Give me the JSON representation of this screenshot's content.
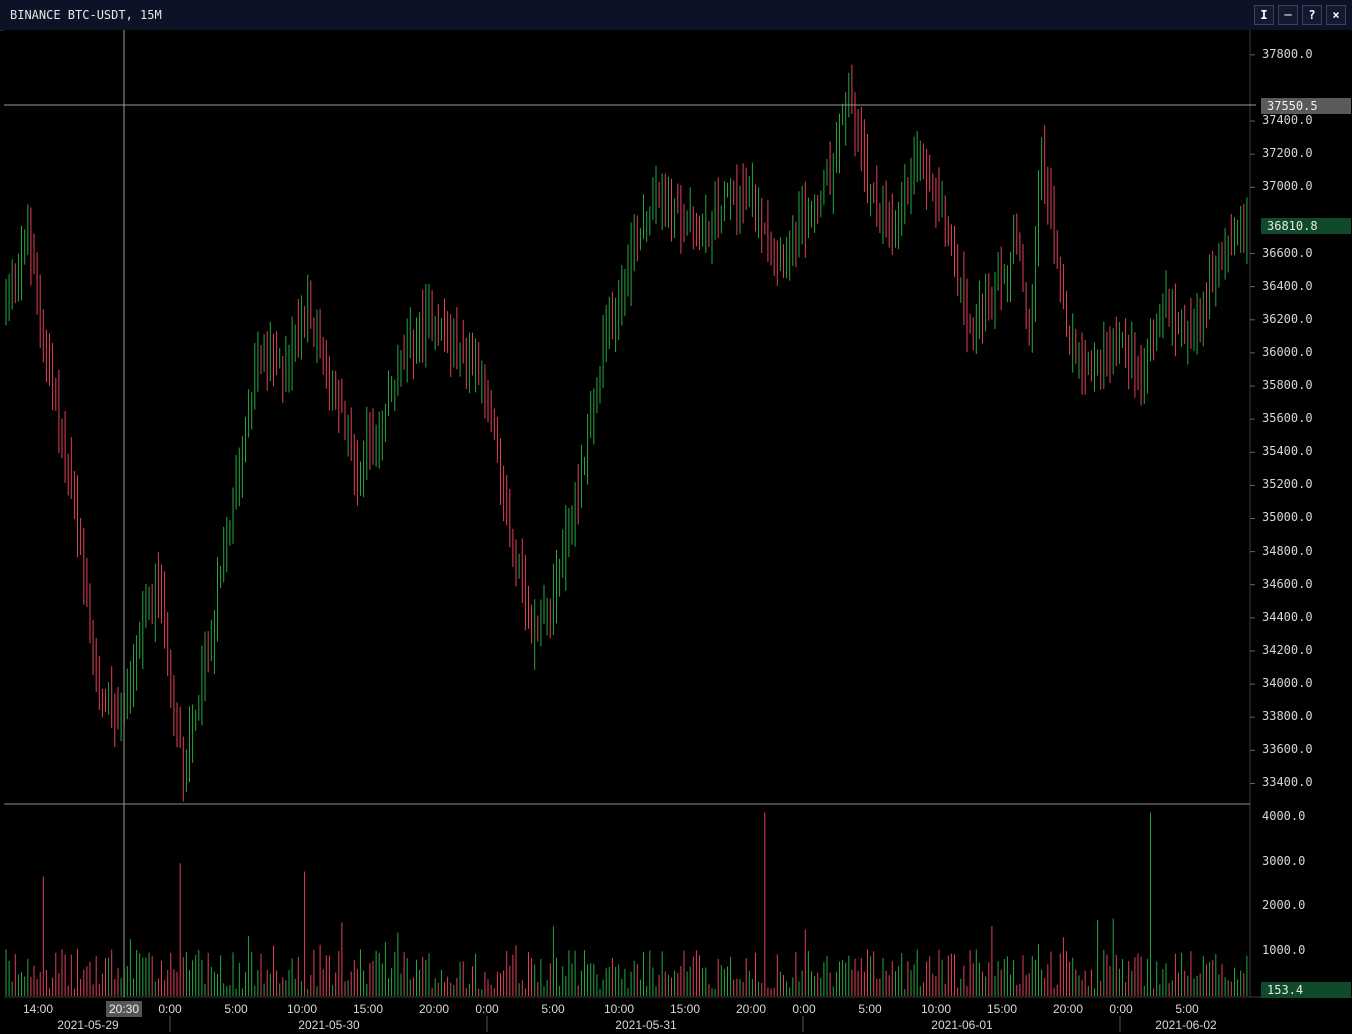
{
  "window": {
    "title": "BINANCE BTC-USDT, 15M",
    "buttons": [
      "I",
      "─",
      "?",
      "×"
    ]
  },
  "chart_data": {
    "type": "bar",
    "subtype": "ohlc",
    "title": "BINANCE BTC-USDT, 15M",
    "price_axis_labels": [
      "37800.0",
      "37400.0",
      "37200.0",
      "37000.0",
      "36600.0",
      "36400.0",
      "36200.0",
      "36000.0",
      "35800.0",
      "35600.0",
      "35400.0",
      "35200.0",
      "35000.0",
      "34800.0",
      "34600.0",
      "34400.0",
      "34200.0",
      "34000.0",
      "33800.0",
      "33600.0",
      "33400.0"
    ],
    "price_ylim": [
      33300,
      37950
    ],
    "volume_axis_labels": [
      "4000.0",
      "3000.0",
      "2000.0",
      "1000.0"
    ],
    "volume_ylim": [
      0,
      4200
    ],
    "time_labels": [
      "14:00",
      "0:00",
      "5:00",
      "10:00",
      "15:00",
      "20:00",
      "0:00",
      "5:00",
      "10:00",
      "15:00",
      "20:00",
      "0:00",
      "5:00",
      "10:00",
      "15:00",
      "20:00",
      "0:00",
      "5:00"
    ],
    "date_labels": [
      "2021-05-29",
      "2021-05-30",
      "2021-05-31",
      "2021-06-01",
      "2021-06-02"
    ],
    "crosshair": {
      "price": "37550.5",
      "time": "20:30"
    },
    "last_price": "36810.8",
    "last_volume": "153.4",
    "colors": {
      "up": "#26a641",
      "down": "#e0415a",
      "crosshair": "#9a9a9a",
      "grid": "#3a3a3a"
    },
    "price_path": [
      [
        0,
        36300
      ],
      [
        8,
        36700
      ],
      [
        14,
        36000
      ],
      [
        22,
        35200
      ],
      [
        30,
        34000
      ],
      [
        38,
        33800
      ],
      [
        44,
        34300
      ],
      [
        50,
        34600
      ],
      [
        58,
        33500
      ],
      [
        66,
        34200
      ],
      [
        74,
        35100
      ],
      [
        82,
        36000
      ],
      [
        90,
        35900
      ],
      [
        98,
        36300
      ],
      [
        106,
        35800
      ],
      [
        114,
        35300
      ],
      [
        122,
        35600
      ],
      [
        130,
        36000
      ],
      [
        138,
        36250
      ],
      [
        146,
        36000
      ],
      [
        154,
        35900
      ],
      [
        162,
        35000
      ],
      [
        170,
        34300
      ],
      [
        178,
        34600
      ],
      [
        186,
        35300
      ],
      [
        194,
        36100
      ],
      [
        202,
        36600
      ],
      [
        210,
        37000
      ],
      [
        218,
        36800
      ],
      [
        226,
        36700
      ],
      [
        234,
        37000
      ],
      [
        242,
        36900
      ],
      [
        250,
        36600
      ],
      [
        258,
        36800
      ],
      [
        266,
        37050
      ],
      [
        272,
        37600
      ],
      [
        278,
        37000
      ],
      [
        286,
        36700
      ],
      [
        294,
        37200
      ],
      [
        302,
        36900
      ],
      [
        310,
        36200
      ],
      [
        318,
        36300
      ],
      [
        326,
        36650
      ],
      [
        330,
        36100
      ],
      [
        334,
        37200
      ],
      [
        342,
        36100
      ],
      [
        350,
        35900
      ],
      [
        358,
        36100
      ],
      [
        366,
        35900
      ],
      [
        374,
        36300
      ],
      [
        382,
        36100
      ],
      [
        390,
        36500
      ],
      [
        398,
        36800
      ]
    ]
  }
}
